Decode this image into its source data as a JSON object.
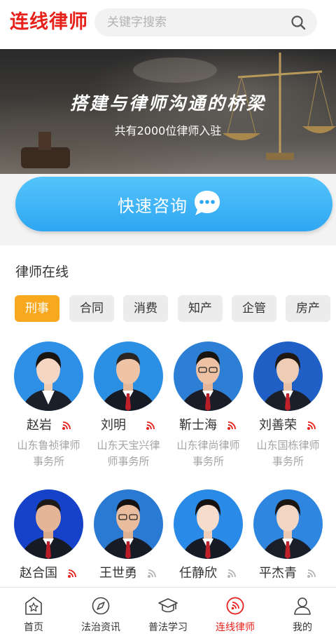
{
  "app": {
    "title": "连线律师"
  },
  "search": {
    "placeholder": "关键字搜索"
  },
  "banner": {
    "headline": "搭建与律师沟通的桥梁",
    "subtitle": "共有2000位律师入驻",
    "consult_label": "快速咨询"
  },
  "section": {
    "title": "律师在线"
  },
  "categories": [
    {
      "label": "刑事",
      "active": true
    },
    {
      "label": "合同",
      "active": false
    },
    {
      "label": "消费",
      "active": false
    },
    {
      "label": "知产",
      "active": false
    },
    {
      "label": "企管",
      "active": false
    },
    {
      "label": "房产",
      "active": false
    }
  ],
  "lawyers": [
    {
      "name": "赵岩",
      "firm": "山东鲁祯律师事务所",
      "firm_line1": "山东鲁祯律师",
      "firm_line2": "事务所",
      "online": true
    },
    {
      "name": "刘明",
      "firm": "山东天宝兴律师事务所",
      "firm_line1": "山东天宝兴律",
      "firm_line2": "师事务所",
      "online": true
    },
    {
      "name": "靳士海",
      "firm": "山东律尚律师事务所",
      "firm_line1": "山东律尚律师",
      "firm_line2": "事务所",
      "online": true
    },
    {
      "name": "刘善荣",
      "firm": "山东国栋律师事务所",
      "firm_line1": "山东国栋律师",
      "firm_line2": "事务所",
      "online": true
    },
    {
      "name": "赵合国",
      "firm": "",
      "online": true
    },
    {
      "name": "王世勇",
      "firm": "",
      "online": false
    },
    {
      "name": "任静欣",
      "firm": "",
      "online": false
    },
    {
      "name": "平杰青",
      "firm": "",
      "online": false
    }
  ],
  "tabs": [
    {
      "label": "首页",
      "icon": "home-star-icon",
      "active": false
    },
    {
      "label": "法治资讯",
      "icon": "compass-icon",
      "active": false
    },
    {
      "label": "普法学习",
      "icon": "graduation-cap-icon",
      "active": false
    },
    {
      "label": "连线律师",
      "icon": "lawyer-call-icon",
      "active": true
    },
    {
      "label": "我的",
      "icon": "user-icon",
      "active": false
    }
  ],
  "colors": {
    "brand_red": "#e8201a",
    "accent_orange": "#f8a81d",
    "consult_blue": "#2ea6f2",
    "online_red": "#e8201a",
    "offline_gray": "#b5b5b5"
  }
}
